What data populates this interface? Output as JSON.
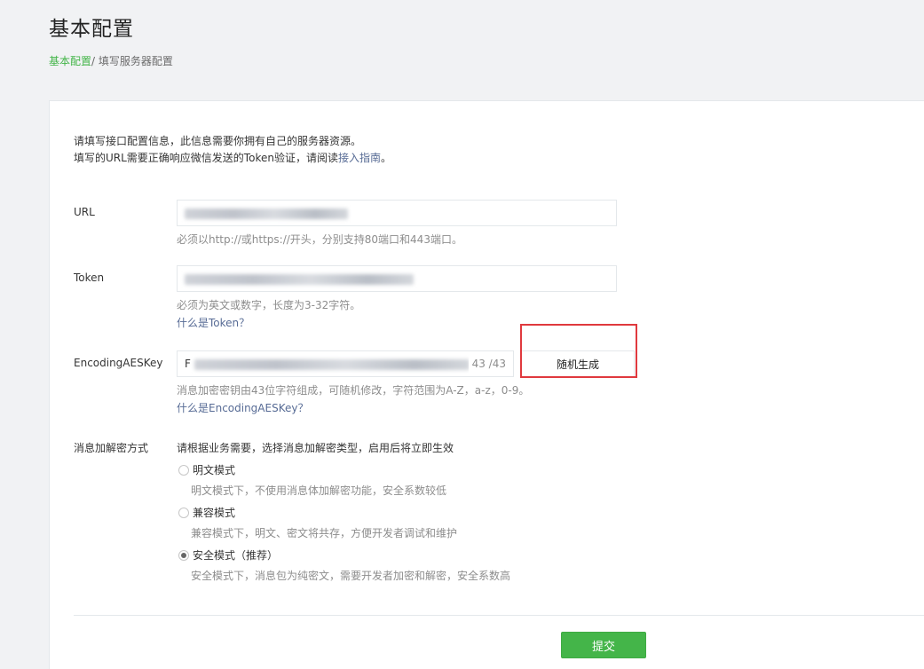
{
  "header": {
    "title": "基本配置",
    "breadcrumb_link": "基本配置",
    "breadcrumb_current": "/ 填写服务器配置"
  },
  "intro": {
    "line1": "请填写接口配置信息，此信息需要你拥有自己的服务器资源。",
    "line2_prefix": "填写的URL需要正确响应微信发送的Token验证，请阅读",
    "line2_link": "接入指南",
    "line2_suffix": "。"
  },
  "url": {
    "label": "URL",
    "hint": "必须以http://或https://开头，分别支持80端口和443端口。"
  },
  "token": {
    "label": "Token",
    "hint": "必须为英文或数字，长度为3-32字符。",
    "help_link": "什么是Token？"
  },
  "aes": {
    "label": "EncodingAESKey",
    "value_prefix": "F",
    "counter": "43 /43",
    "random_button": "随机生成",
    "hint": "消息加密密钥由43位字符组成，可随机修改，字符范围为A-Z，a-z，0-9。",
    "help_link": "什么是EncodingAESKey？"
  },
  "encryption": {
    "label": "消息加解密方式",
    "intro": "请根据业务需要，选择消息加解密类型，启用后将立即生效",
    "options": [
      {
        "label": "明文模式",
        "desc": "明文模式下，不使用消息体加解密功能，安全系数较低",
        "selected": false
      },
      {
        "label": "兼容模式",
        "desc": "兼容模式下，明文、密文将共存，方便开发者调试和维护",
        "selected": false
      },
      {
        "label": "安全模式（推荐）",
        "desc": "安全模式下，消息包为纯密文，需要开发者加密和解密，安全系数高",
        "selected": true
      }
    ]
  },
  "footer": {
    "submit_button": "提交"
  },
  "colors": {
    "accent": "#44b549",
    "link": "#576b95",
    "highlight_box": "#e0393e"
  }
}
